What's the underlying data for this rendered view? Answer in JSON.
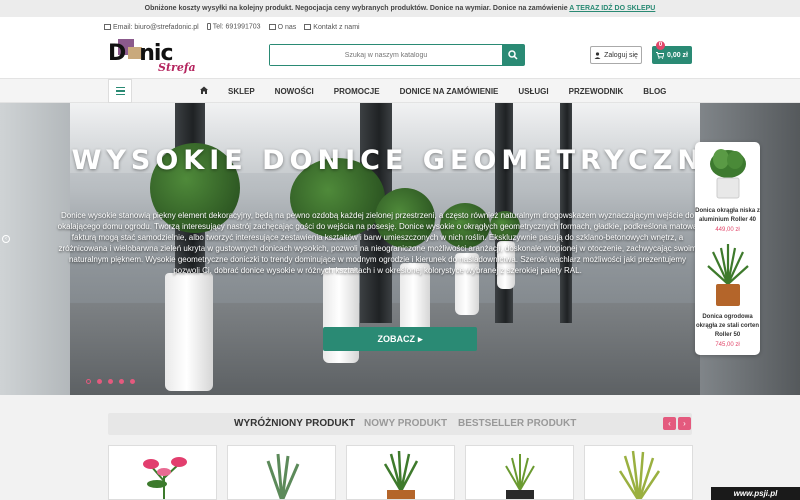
{
  "topbar": {
    "text": "Obniżone koszty wysyłki na kolejny produkt. Negocjacja ceny wybranych produktów. Donice na wymiar. Donice na zamówienie",
    "link": "A TERAZ IDŹ DO SKLEPU"
  },
  "contact": {
    "email": "Email: biuro@strefadonic.pl",
    "phone": "Tel: 691991703",
    "about": "O nas",
    "contact_link": "Kontakt z nami"
  },
  "logo": {
    "word_d": "D",
    "word_rest": "nic",
    "strefa": "Strefa"
  },
  "search": {
    "placeholder": "Szukaj w naszym katalogu",
    "icon": "search-icon"
  },
  "account": {
    "login": "Zaloguj się"
  },
  "cart": {
    "count": "0",
    "total": "0,00 zł"
  },
  "nav": {
    "home_icon": "home-icon",
    "items": [
      "SKLEP",
      "NOWOŚCI",
      "PROMOCJE",
      "DONICE NA ZAMÓWIENIE",
      "USŁUGI",
      "PRZEWODNIK",
      "BLOG"
    ]
  },
  "hero": {
    "title": "WYSOKIE DONICE GEOMETRYCZNE",
    "description": "Donice wysokie stanowią piękny element dekoracyjny, będą na pewno ozdobą każdej zielonej przestrzeni, a często również naturalnym drogowskazem wyznaczającym wejście do okalającego domu ogrodu. Tworzą interesujący nastrój zachęcając gości do wejścia na posesję. Donice wysokie o okrągłych geometrycznych formach, gładkie, podkreślona matową fakturą mogą stać samodzielnie, albo tworzyć interesujące zestawienia kształtów i barw umieszczonych w nich roślin. Ekskluzywnie pasują do szklano-betonowych wnętrz, a zróżnicowana i wielobarwna zieleń ukryta w gustownych donicach wysokich, pozwoli na nieograniczone możliwości aranżacji, doskonale wtopionej w otoczenie, zachwycając swoim naturalnym pięknem. Wysokie geometryczne doniczki to trendy dominujące w modnym ogrodzie i kierunek do naśladownictwa. Szeroki wachlarz możliwości jaki prezentujemy pozwoli Ci, dobrać donice wysokie w różnych kształtach i w określonej kolorystyce wybranej z szerokiej palety RAL.",
    "cta": "ZOBACZ",
    "slides": 5,
    "active_slide": 1
  },
  "side_products": [
    {
      "name": "Donica okrągła niska z aluminium Roller 40",
      "price": "449,00 zł"
    },
    {
      "name": "Donica ogrodowa okrągła ze stali corten Roller 50",
      "price": "745,00 zł"
    }
  ],
  "featured": {
    "tabs": [
      "WYRÓŻNIONY PRODUKT",
      "NOWY PRODUKT",
      "BESTSELLER PRODUKT"
    ],
    "active_tab": 0,
    "prev": "‹",
    "next": "›",
    "cards": 5
  },
  "watermark": "www.psji.pl",
  "colors": {
    "accent": "#2a8a74",
    "pink": "#e2466a"
  }
}
